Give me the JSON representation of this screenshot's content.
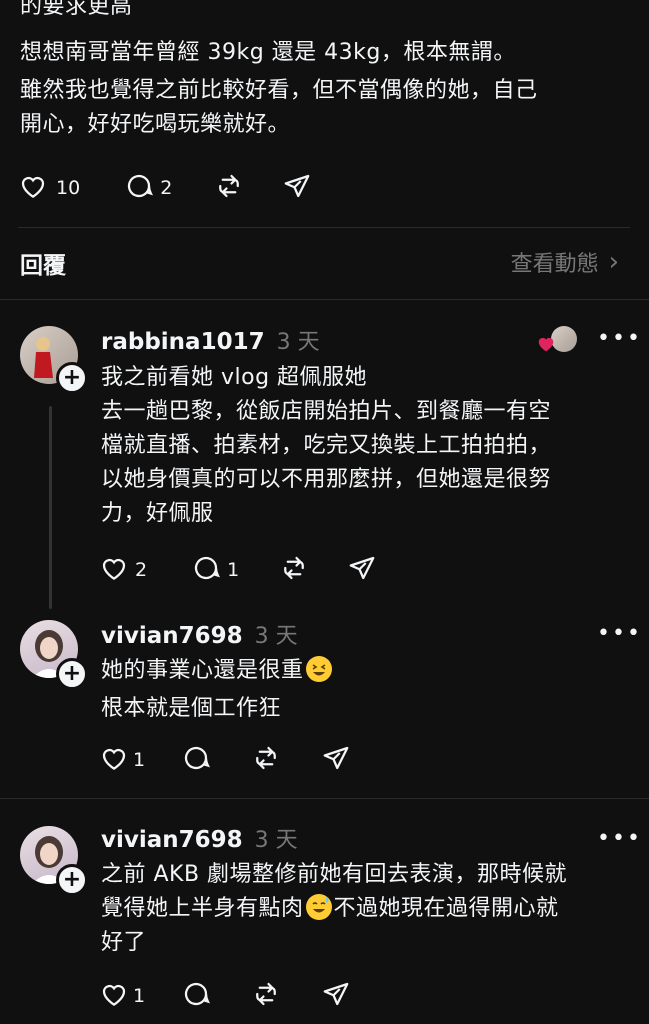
{
  "top_post": {
    "lines": [
      "的要求更高",
      "想想南哥當年曾經 39kg 還是 43kg，根本無謂。",
      "雖然我也覺得之前比較好看，但不當偶像的她，自己",
      "開心，好好吃喝玩樂就好。"
    ],
    "likes": "10",
    "replies": "2"
  },
  "reply_bar": {
    "label": "回覆",
    "activity_link": "查看動態"
  },
  "comments": [
    {
      "username": "rabbina1017",
      "time": "3 天",
      "lines": [
        "我之前看她 vlog 超佩服她",
        "去一趟巴黎，從飯店開始拍片、到餐廳一有空",
        "檔就直播、拍素材，吃完又換裝上工拍拍拍，",
        "以她身價真的可以不用那麼拼，但她還是很努",
        "力，好佩服"
      ],
      "likes": "2",
      "replies": "1"
    },
    {
      "username": "vivian7698",
      "time": "3 天",
      "line1": "她的事業心還是很重",
      "line2": "根本就是個工作狂",
      "likes": "1",
      "replies": ""
    },
    {
      "username": "vivian7698",
      "time": "3 天",
      "line1": "之前 AKB 劇場整修前她有回去表演，那時候就",
      "line2a": "覺得她上半身有點肉",
      "line2b": "不過她現在過得開心就",
      "line3": "好了",
      "likes": "1",
      "replies": ""
    }
  ],
  "icons": {
    "like": "heart-icon",
    "reply": "comment-bubble-icon",
    "repost": "repost-icon",
    "share": "send-icon",
    "more": "more-dots-icon",
    "follow": "plus-icon",
    "chevron": "chevron-right-icon",
    "emoji_1": "grinning-squinting-face-emoji",
    "emoji_2": "grinning-face-with-sweat-emoji"
  },
  "more_glyph": "•••",
  "plus_glyph": "+",
  "chevron_glyph": "›",
  "colors": {
    "background": "#101010",
    "text": "#f3f5f7",
    "muted": "#777777",
    "divider": "#2a2a2a",
    "like_heart": "#e0245e"
  }
}
